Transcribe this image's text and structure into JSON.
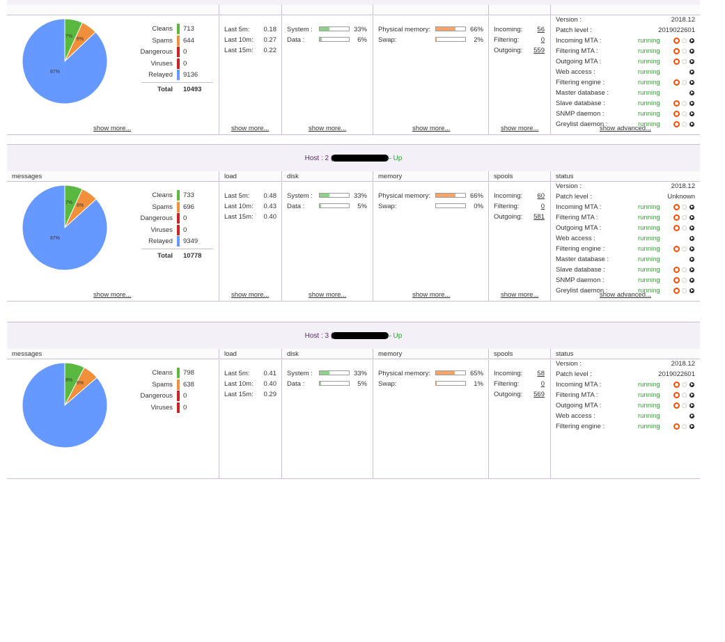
{
  "hosts": [
    {
      "title_prefix": "",
      "title_suffix": "",
      "messages": {
        "header": "",
        "pie_labels": [
          "7%",
          "6%",
          "87%"
        ],
        "legend": [
          {
            "label": "Cleans",
            "value": "713",
            "color": "#58b840"
          },
          {
            "label": "Spams",
            "value": "644",
            "color": "#f0903a"
          },
          {
            "label": "Dangerous",
            "value": "0",
            "color": "#cc2222"
          },
          {
            "label": "Viruses",
            "value": "0",
            "color": "#cc2222"
          },
          {
            "label": "Relayed",
            "value": "9136",
            "color": "#6699ff"
          }
        ],
        "total_label": "Total",
        "total_value": "10493",
        "show_more": "show more..."
      },
      "load": {
        "header": "",
        "rows": [
          {
            "label": "Last 5m:",
            "value": "0.18"
          },
          {
            "label": "Last 10m:",
            "value": "0.27"
          },
          {
            "label": "Last 15m:",
            "value": "0.22"
          }
        ],
        "show_more": "show more..."
      },
      "disk": {
        "header": "",
        "rows": [
          {
            "label": "System :",
            "value": "33%",
            "pct": 33
          },
          {
            "label": "Data :",
            "value": "6%",
            "pct": 6
          }
        ],
        "show_more": "show more..."
      },
      "memory": {
        "header": "",
        "rows": [
          {
            "label": "Physical memory:",
            "value": "66%",
            "pct": 66
          },
          {
            "label": "Swap:",
            "value": "2%",
            "pct": 2
          }
        ],
        "show_more": "show more..."
      },
      "spools": {
        "header": "",
        "rows": [
          {
            "label": "Incoming:",
            "value": "56"
          },
          {
            "label": "Filtering:",
            "value": "0"
          },
          {
            "label": "Outgoing:",
            "value": "559"
          }
        ],
        "show_more": "show more..."
      },
      "status": {
        "header": "",
        "version_label": "Version :",
        "version": "2018.12",
        "patch_label": "Patch level :",
        "patch": "2019022601",
        "services": [
          {
            "name": "Incoming MTA :",
            "state": "running",
            "stop": true,
            "restart": true
          },
          {
            "name": "Filtering MTA :",
            "state": "running",
            "stop": true,
            "restart": true
          },
          {
            "name": "Outgoing MTA :",
            "state": "running",
            "stop": true,
            "restart": true
          },
          {
            "name": "Web access :",
            "state": "running",
            "stop": false,
            "restart": false
          },
          {
            "name": "Filtering engine :",
            "state": "running",
            "stop": true,
            "restart": true
          },
          {
            "name": "Master database :",
            "state": "running",
            "stop": false,
            "restart": false
          },
          {
            "name": "Slave database :",
            "state": "running",
            "stop": true,
            "restart": true
          },
          {
            "name": "SNMP daemon :",
            "state": "running",
            "stop": true,
            "restart": true
          },
          {
            "name": "Greylist daemon :",
            "state": "running",
            "stop": true,
            "restart": true
          }
        ],
        "show_advanced": "show advanced..."
      }
    },
    {
      "title_prefix": "Host : 2 (",
      "title_suffix": "– Up",
      "messages": {
        "header": "messages",
        "pie_labels": [
          "7%",
          "6%",
          "87%"
        ],
        "legend": [
          {
            "label": "Cleans",
            "value": "733",
            "color": "#58b840"
          },
          {
            "label": "Spams",
            "value": "696",
            "color": "#f0903a"
          },
          {
            "label": "Dangerous",
            "value": "0",
            "color": "#cc2222"
          },
          {
            "label": "Viruses",
            "value": "0",
            "color": "#cc2222"
          },
          {
            "label": "Relayed",
            "value": "9349",
            "color": "#6699ff"
          }
        ],
        "total_label": "Total",
        "total_value": "10778",
        "show_more": "show more..."
      },
      "load": {
        "header": "load",
        "rows": [
          {
            "label": "Last 5m:",
            "value": "0.48"
          },
          {
            "label": "Last 10m:",
            "value": "0.43"
          },
          {
            "label": "Last 15m:",
            "value": "0.40"
          }
        ],
        "show_more": "show more..."
      },
      "disk": {
        "header": "disk",
        "rows": [
          {
            "label": "System :",
            "value": "33%",
            "pct": 33
          },
          {
            "label": "Data :",
            "value": "5%",
            "pct": 5
          }
        ],
        "show_more": "show more..."
      },
      "memory": {
        "header": "memory",
        "rows": [
          {
            "label": "Physical memory:",
            "value": "66%",
            "pct": 66
          },
          {
            "label": "Swap:",
            "value": "0%",
            "pct": 0
          }
        ],
        "show_more": "show more..."
      },
      "spools": {
        "header": "spools",
        "rows": [
          {
            "label": "Incoming:",
            "value": "60"
          },
          {
            "label": "Filtering:",
            "value": "0"
          },
          {
            "label": "Outgoing:",
            "value": "581"
          }
        ],
        "show_more": "show more..."
      },
      "status": {
        "header": "status",
        "version_label": "Version :",
        "version": "2018.12",
        "patch_label": "Patch level :",
        "patch": "Unknown",
        "services": [
          {
            "name": "Incoming MTA :",
            "state": "running",
            "stop": true,
            "restart": true
          },
          {
            "name": "Filtering MTA :",
            "state": "running",
            "stop": true,
            "restart": true
          },
          {
            "name": "Outgoing MTA :",
            "state": "running",
            "stop": true,
            "restart": true
          },
          {
            "name": "Web access :",
            "state": "running",
            "stop": false,
            "restart": false
          },
          {
            "name": "Filtering engine :",
            "state": "running",
            "stop": true,
            "restart": true
          },
          {
            "name": "Master database :",
            "state": "running",
            "stop": false,
            "restart": false
          },
          {
            "name": "Slave database :",
            "state": "running",
            "stop": true,
            "restart": true
          },
          {
            "name": "SNMP daemon :",
            "state": "running",
            "stop": true,
            "restart": true
          },
          {
            "name": "Greylist daemon :",
            "state": "running",
            "stop": true,
            "restart": true
          }
        ],
        "show_advanced": "show advanced..."
      }
    },
    {
      "title_prefix": "Host : 3 (",
      "title_suffix": "– Up",
      "messages": {
        "header": "messages",
        "pie_labels": [
          "8%",
          "6%",
          ""
        ],
        "legend": [
          {
            "label": "Cleans",
            "value": "798",
            "color": "#58b840"
          },
          {
            "label": "Spams",
            "value": "638",
            "color": "#f0903a"
          },
          {
            "label": "Dangerous",
            "value": "0",
            "color": "#cc2222"
          },
          {
            "label": "Viruses",
            "value": "0",
            "color": "#cc2222"
          }
        ],
        "total_label": "",
        "total_value": "",
        "show_more": ""
      },
      "load": {
        "header": "load",
        "rows": [
          {
            "label": "Last 5m:",
            "value": "0.41"
          },
          {
            "label": "Last 10m:",
            "value": "0.40"
          },
          {
            "label": "Last 15m:",
            "value": "0.29"
          }
        ],
        "show_more": ""
      },
      "disk": {
        "header": "disk",
        "rows": [
          {
            "label": "System :",
            "value": "33%",
            "pct": 33
          },
          {
            "label": "Data :",
            "value": "5%",
            "pct": 5
          }
        ],
        "show_more": ""
      },
      "memory": {
        "header": "memory",
        "rows": [
          {
            "label": "Physical memory:",
            "value": "65%",
            "pct": 65
          },
          {
            "label": "Swap:",
            "value": "1%",
            "pct": 1
          }
        ],
        "show_more": ""
      },
      "spools": {
        "header": "spools",
        "rows": [
          {
            "label": "Incoming:",
            "value": "58"
          },
          {
            "label": "Filtering:",
            "value": "0"
          },
          {
            "label": "Outgoing:",
            "value": "569"
          }
        ],
        "show_more": ""
      },
      "status": {
        "header": "status",
        "version_label": "Version :",
        "version": "2018.12",
        "patch_label": "Patch level :",
        "patch": "2019022601",
        "services": [
          {
            "name": "Incoming MTA :",
            "state": "running",
            "stop": true,
            "restart": true
          },
          {
            "name": "Filtering MTA :",
            "state": "running",
            "stop": true,
            "restart": true
          },
          {
            "name": "Outgoing MTA :",
            "state": "running",
            "stop": true,
            "restart": true
          },
          {
            "name": "Web access :",
            "state": "running",
            "stop": false,
            "restart": false
          },
          {
            "name": "Filtering engine :",
            "state": "running",
            "stop": true,
            "restart": true
          }
        ],
        "show_advanced": ""
      }
    }
  ]
}
